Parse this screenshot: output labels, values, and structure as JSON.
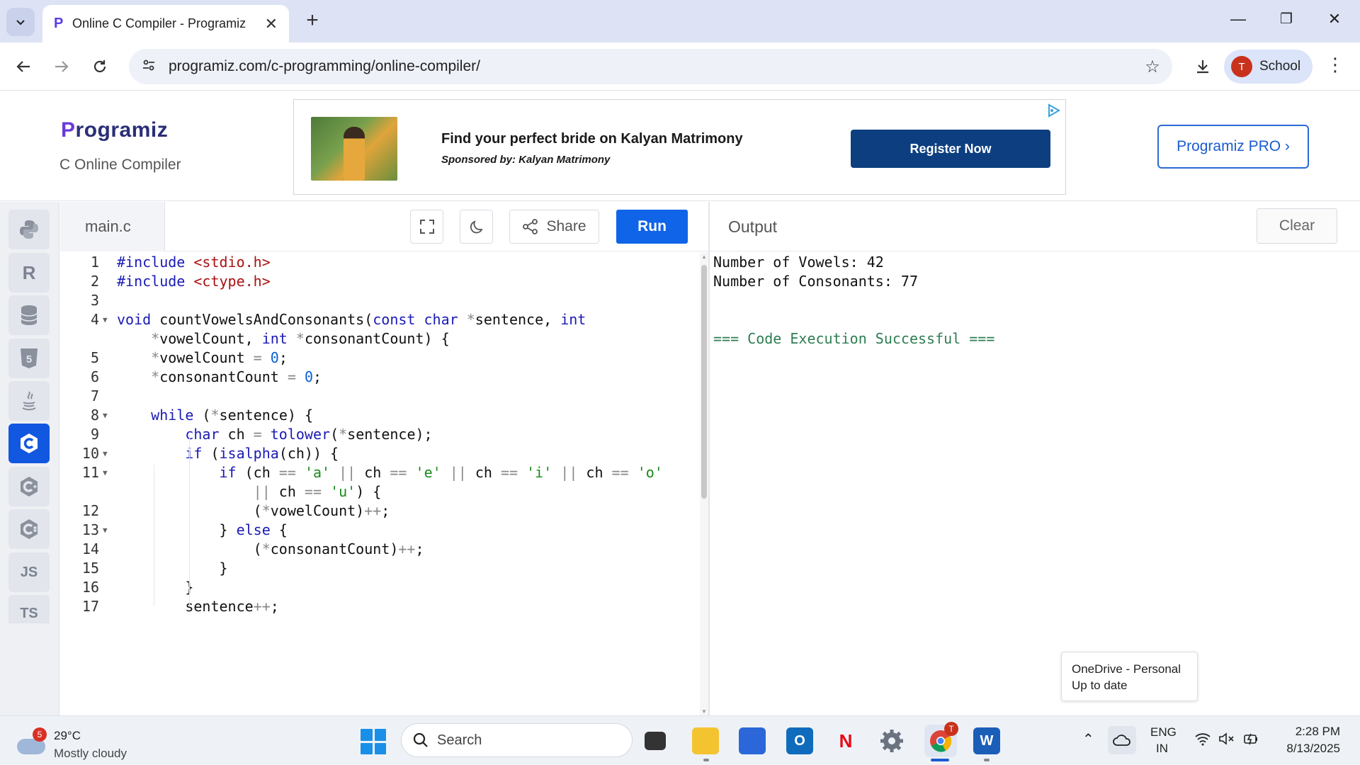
{
  "browser": {
    "tab_title": "Online C Compiler - Programiz",
    "url": "programiz.com/c-programming/online-compiler/",
    "profile_initial": "T",
    "profile_name": "School"
  },
  "site": {
    "logo_text": "rogramiz",
    "logo_p": "P",
    "subtitle": "C Online Compiler",
    "pro_button": "Programiz PRO ›"
  },
  "ad": {
    "headline": "Find your perfect bride on Kalyan Matrimony",
    "sponsor": "Sponsored by: Kalyan Matrimony",
    "cta": "Register Now"
  },
  "languages": [
    {
      "name": "python-icon",
      "label": ""
    },
    {
      "name": "r-icon",
      "label": "R"
    },
    {
      "name": "database-icon",
      "label": ""
    },
    {
      "name": "html5-icon",
      "label": "5"
    },
    {
      "name": "java-icon",
      "label": ""
    },
    {
      "name": "c-icon",
      "label": "C"
    },
    {
      "name": "cpp-icon",
      "label": "C"
    },
    {
      "name": "csharp-icon",
      "label": "C"
    },
    {
      "name": "javascript-icon",
      "label": "JS"
    },
    {
      "name": "typescript-icon",
      "label": "TS"
    }
  ],
  "editor": {
    "filename": "main.c",
    "share_label": "Share",
    "run_label": "Run",
    "lines": [
      {
        "n": "1",
        "fold": false,
        "indent": 0,
        "html": "<span class='kw'>#include</span> <span class='str'>&lt;stdio.h&gt;</span>"
      },
      {
        "n": "2",
        "fold": false,
        "indent": 0,
        "html": "<span class='kw'>#include</span> <span class='str'>&lt;ctype.h&gt;</span>"
      },
      {
        "n": "3",
        "fold": false,
        "indent": 0,
        "html": ""
      },
      {
        "n": "4",
        "fold": true,
        "indent": 0,
        "html": "<span class='ty'>void</span> countVowelsAndConsonants(<span class='ty'>const</span> <span class='ty'>char</span> <span class='op'>*</span>sentence, <span class='ty'>int</span>"
      },
      {
        "n": "",
        "fold": false,
        "indent": 0,
        "html": "    <span class='op'>*</span>vowelCount, <span class='ty'>int</span> <span class='op'>*</span>consonantCount) {"
      },
      {
        "n": "5",
        "fold": false,
        "indent": 0,
        "html": "    <span class='op'>*</span>vowelCount <span class='op'>=</span> <span class='num'>0</span>;"
      },
      {
        "n": "6",
        "fold": false,
        "indent": 0,
        "html": "    <span class='op'>*</span>consonantCount <span class='op'>=</span> <span class='num'>0</span>;"
      },
      {
        "n": "7",
        "fold": false,
        "indent": 0,
        "html": ""
      },
      {
        "n": "8",
        "fold": true,
        "indent": 0,
        "html": "    <span class='kw'>while</span> (<span class='op'>*</span>sentence) {"
      },
      {
        "n": "9",
        "fold": false,
        "indent": 0,
        "html": "        <span class='ty'>char</span> ch <span class='op'>=</span> <span class='kw'>tolower</span>(<span class='op'>*</span>sentence);"
      },
      {
        "n": "10",
        "fold": true,
        "indent": 0,
        "html": "        <span class='kw'>if</span> (<span class='kw'>isalpha</span>(ch)) {"
      },
      {
        "n": "11",
        "fold": true,
        "indent": 0,
        "html": "            <span class='kw'>if</span> (ch <span class='op'>==</span> <span class='ch'>'a'</span> <span class='op'>||</span> ch <span class='op'>==</span> <span class='ch'>'e'</span> <span class='op'>||</span> ch <span class='op'>==</span> <span class='ch'>'i'</span> <span class='op'>||</span> ch <span class='op'>==</span> <span class='ch'>'o'</span>"
      },
      {
        "n": "",
        "fold": false,
        "indent": 0,
        "html": "                <span class='op'>||</span> ch <span class='op'>==</span> <span class='ch'>'u'</span>) {"
      },
      {
        "n": "12",
        "fold": false,
        "indent": 0,
        "html": "                (<span class='op'>*</span>vowelCount)<span class='op'>++</span>;"
      },
      {
        "n": "13",
        "fold": true,
        "indent": 0,
        "html": "            } <span class='kw'>else</span> {"
      },
      {
        "n": "14",
        "fold": false,
        "indent": 0,
        "html": "                (<span class='op'>*</span>consonantCount)<span class='op'>++</span>;"
      },
      {
        "n": "15",
        "fold": false,
        "indent": 0,
        "html": "            }"
      },
      {
        "n": "16",
        "fold": false,
        "indent": 0,
        "html": "        }"
      },
      {
        "n": "17",
        "fold": false,
        "indent": 0,
        "html": "        sentence<span class='op'>++</span>;"
      }
    ]
  },
  "output": {
    "title": "Output",
    "clear_label": "Clear",
    "lines": [
      {
        "text": "Number of Vowels: 42",
        "cls": ""
      },
      {
        "text": "Number of Consonants: 77",
        "cls": ""
      },
      {
        "text": "",
        "cls": ""
      },
      {
        "text": "",
        "cls": ""
      },
      {
        "text": "=== Code Execution Successful ===",
        "cls": "succ"
      }
    ]
  },
  "toast": {
    "line1": "OneDrive - Personal",
    "line2": "Up to date"
  },
  "taskbar": {
    "weather_badge": "5",
    "temp": "29°C",
    "weather": "Mostly cloudy",
    "search_label": "Search",
    "lang1": "ENG",
    "lang2": "IN",
    "time": "2:28 PM",
    "date": "8/13/2025",
    "chrome_badge": "T"
  },
  "colors": {
    "accent": "#1064e8",
    "active_lang": "#1257e0",
    "success": "#2e7d52"
  }
}
